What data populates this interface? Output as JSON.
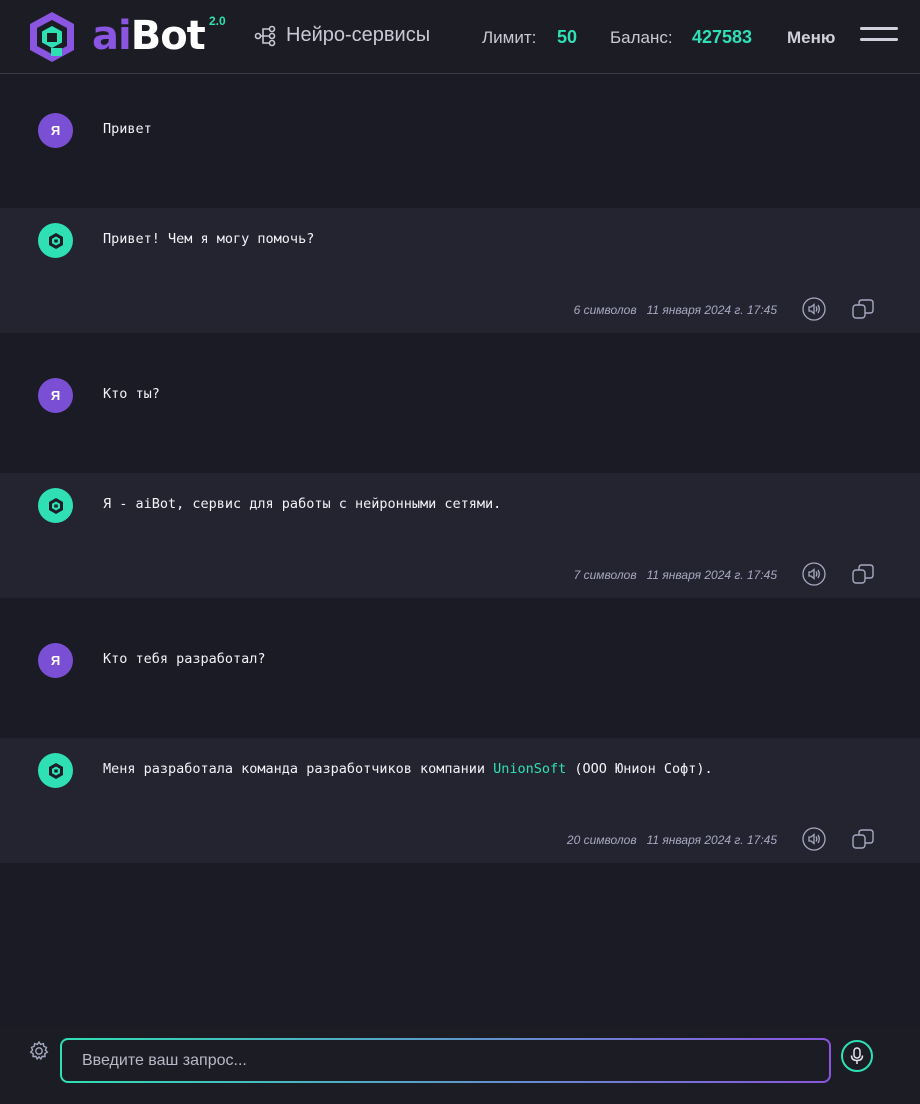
{
  "header": {
    "logo_ai": "ai",
    "logo_bot": "Bot",
    "logo_version": "2.0",
    "services_label": "Нейро-сервисы",
    "limit_label": "Лимит:",
    "limit_value": "50",
    "balance_label": "Баланс:",
    "balance_value": "427583",
    "menu_label": "Меню"
  },
  "messages": [
    {
      "role": "user",
      "avatar": "Я",
      "text": "Привет"
    },
    {
      "role": "bot",
      "text": "Привет! Чем я могу помочь?",
      "chars": "6 символов",
      "date": "11 января 2024 г. 17:45"
    },
    {
      "role": "user",
      "avatar": "Я",
      "text": "Кто ты?"
    },
    {
      "role": "bot",
      "text": "Я - aiBot, сервис для работы с нейронными сетями.",
      "chars": "7 символов",
      "date": "11 января 2024 г. 17:45"
    },
    {
      "role": "user",
      "avatar": "Я",
      "text": "Кто тебя разработал?"
    },
    {
      "role": "bot",
      "text_before": "Меня разработала команда разработчиков компании ",
      "text_link": "UnionSoft",
      "text_after": " (ООО Юнион Софт).",
      "chars": "20 символов",
      "date": "11 января 2024 г. 17:45"
    }
  ],
  "input": {
    "placeholder": "Введите ваш запрос..."
  },
  "colors": {
    "accent_green": "#2ee0b4",
    "accent_purple": "#8a55e0",
    "background": "#1b1b26",
    "bot_row": "#242431"
  },
  "icons": [
    "services-icon",
    "menu-icon",
    "speaker-icon",
    "copy-icon",
    "settings-icon",
    "microphone-icon",
    "bot-icon"
  ]
}
